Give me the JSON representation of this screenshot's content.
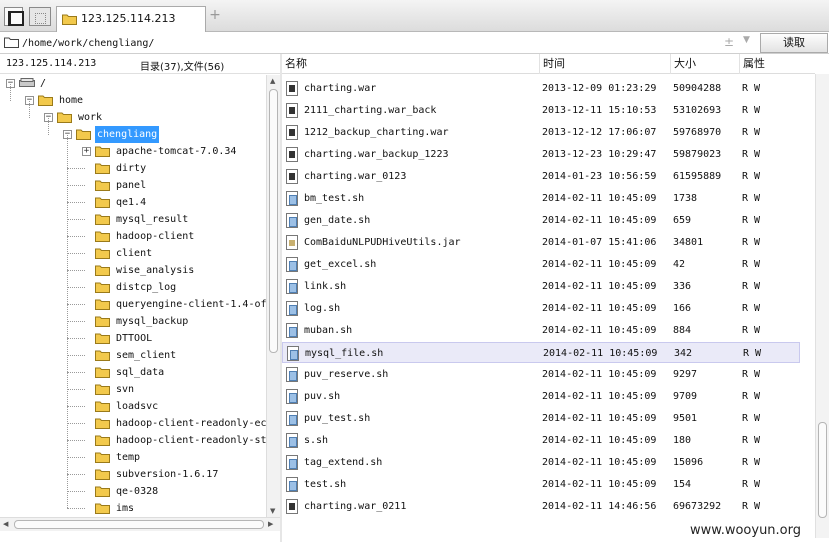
{
  "tab": {
    "title": "123.125.114.213",
    "add_label": "+"
  },
  "path": {
    "value": "/home/work/chengliang/",
    "plusminus": "±",
    "dropdown": "▼",
    "read_label": "读取"
  },
  "left": {
    "host": "123.125.114.213",
    "counts": "目录(37),文件(56)",
    "tree": [
      {
        "label": "/",
        "type": "drive",
        "toggle": "−"
      },
      {
        "label": "home",
        "type": "folder",
        "toggle": "−"
      },
      {
        "label": "work",
        "type": "folder",
        "toggle": "−"
      },
      {
        "label": "chengliang",
        "type": "folder",
        "toggle": "−",
        "selected": true
      },
      {
        "label": "apache-tomcat-7.0.34",
        "type": "folder",
        "toggle": "+"
      },
      {
        "label": "dirty",
        "type": "folder"
      },
      {
        "label": "panel",
        "type": "folder"
      },
      {
        "label": "qe1.4",
        "type": "folder"
      },
      {
        "label": "mysql_result",
        "type": "folder"
      },
      {
        "label": "hadoop-client",
        "type": "folder"
      },
      {
        "label": "client",
        "type": "folder"
      },
      {
        "label": "wise_analysis",
        "type": "folder"
      },
      {
        "label": "distcp_log",
        "type": "folder"
      },
      {
        "label": "queryengine-client-1.4-of",
        "type": "folder"
      },
      {
        "label": "mysql_backup",
        "type": "folder"
      },
      {
        "label": "DTTOOL",
        "type": "folder"
      },
      {
        "label": "sem_client",
        "type": "folder"
      },
      {
        "label": "sql_data",
        "type": "folder"
      },
      {
        "label": "svn",
        "type": "folder"
      },
      {
        "label": "loadsvc",
        "type": "folder"
      },
      {
        "label": "hadoop-client-readonly-ec",
        "type": "folder"
      },
      {
        "label": "hadoop-client-readonly-st",
        "type": "folder"
      },
      {
        "label": "temp",
        "type": "folder"
      },
      {
        "label": "subversion-1.6.17",
        "type": "folder"
      },
      {
        "label": "qe-0328",
        "type": "folder"
      },
      {
        "label": "ims",
        "type": "folder"
      }
    ]
  },
  "columns": {
    "name": "名称",
    "time": "时间",
    "size": "大小",
    "attr": "属性"
  },
  "files": [
    {
      "name": "charting.war",
      "time": "2013-12-09 01:23:29",
      "size": "50904288",
      "attr": "R W",
      "icon": "war"
    },
    {
      "name": "2111_charting.war_back",
      "time": "2013-12-11 15:10:53",
      "size": "53102693",
      "attr": "R W",
      "icon": "war"
    },
    {
      "name": "1212_backup_charting.war",
      "time": "2013-12-12 17:06:07",
      "size": "59768970",
      "attr": "R W",
      "icon": "war"
    },
    {
      "name": "charting.war_backup_1223",
      "time": "2013-12-23 10:29:47",
      "size": "59879023",
      "attr": "R W",
      "icon": "war"
    },
    {
      "name": "charting.war_0123",
      "time": "2014-01-23 10:56:59",
      "size": "61595889",
      "attr": "R W",
      "icon": "war"
    },
    {
      "name": "bm_test.sh",
      "time": "2014-02-11 10:45:09",
      "size": "1738",
      "attr": "R W",
      "icon": "sh"
    },
    {
      "name": "gen_date.sh",
      "time": "2014-02-11 10:45:09",
      "size": "659",
      "attr": "R W",
      "icon": "sh"
    },
    {
      "name": "ComBaiduNLPUDHiveUtils.jar",
      "time": "2014-01-07 15:41:06",
      "size": "34801",
      "attr": "R W",
      "icon": "jar"
    },
    {
      "name": "get_excel.sh",
      "time": "2014-02-11 10:45:09",
      "size": "42",
      "attr": "R W",
      "icon": "sh"
    },
    {
      "name": "link.sh",
      "time": "2014-02-11 10:45:09",
      "size": "336",
      "attr": "R W",
      "icon": "sh"
    },
    {
      "name": "log.sh",
      "time": "2014-02-11 10:45:09",
      "size": "166",
      "attr": "R W",
      "icon": "sh"
    },
    {
      "name": "muban.sh",
      "time": "2014-02-11 10:45:09",
      "size": "884",
      "attr": "R W",
      "icon": "sh"
    },
    {
      "name": "mysql_file.sh",
      "time": "2014-02-11 10:45:09",
      "size": "342",
      "attr": "R W",
      "icon": "sh",
      "highlight": true
    },
    {
      "name": "puv_reserve.sh",
      "time": "2014-02-11 10:45:09",
      "size": "9297",
      "attr": "R W",
      "icon": "sh"
    },
    {
      "name": "puv.sh",
      "time": "2014-02-11 10:45:09",
      "size": "9709",
      "attr": "R W",
      "icon": "sh"
    },
    {
      "name": "puv_test.sh",
      "time": "2014-02-11 10:45:09",
      "size": "9501",
      "attr": "R W",
      "icon": "sh"
    },
    {
      "name": "s.sh",
      "time": "2014-02-11 10:45:09",
      "size": "180",
      "attr": "R W",
      "icon": "sh"
    },
    {
      "name": "tag_extend.sh",
      "time": "2014-02-11 10:45:09",
      "size": "15096",
      "attr": "R W",
      "icon": "sh"
    },
    {
      "name": "test.sh",
      "time": "2014-02-11 10:45:09",
      "size": "154",
      "attr": "R W",
      "icon": "sh"
    },
    {
      "name": "charting.war_0211",
      "time": "2014-02-11 14:46:56",
      "size": "69673292",
      "attr": "R W",
      "icon": "war"
    }
  ],
  "watermark": "www.wooyun.org",
  "colors": {
    "selection": "#3399ff",
    "row_highlight": "#eaeaf8",
    "folder": "#f2c94c"
  },
  "icons": {
    "folder": "folder-icon",
    "drive": "drive-icon",
    "war": "war-file-icon",
    "sh": "shell-file-icon",
    "jar": "jar-file-icon"
  }
}
